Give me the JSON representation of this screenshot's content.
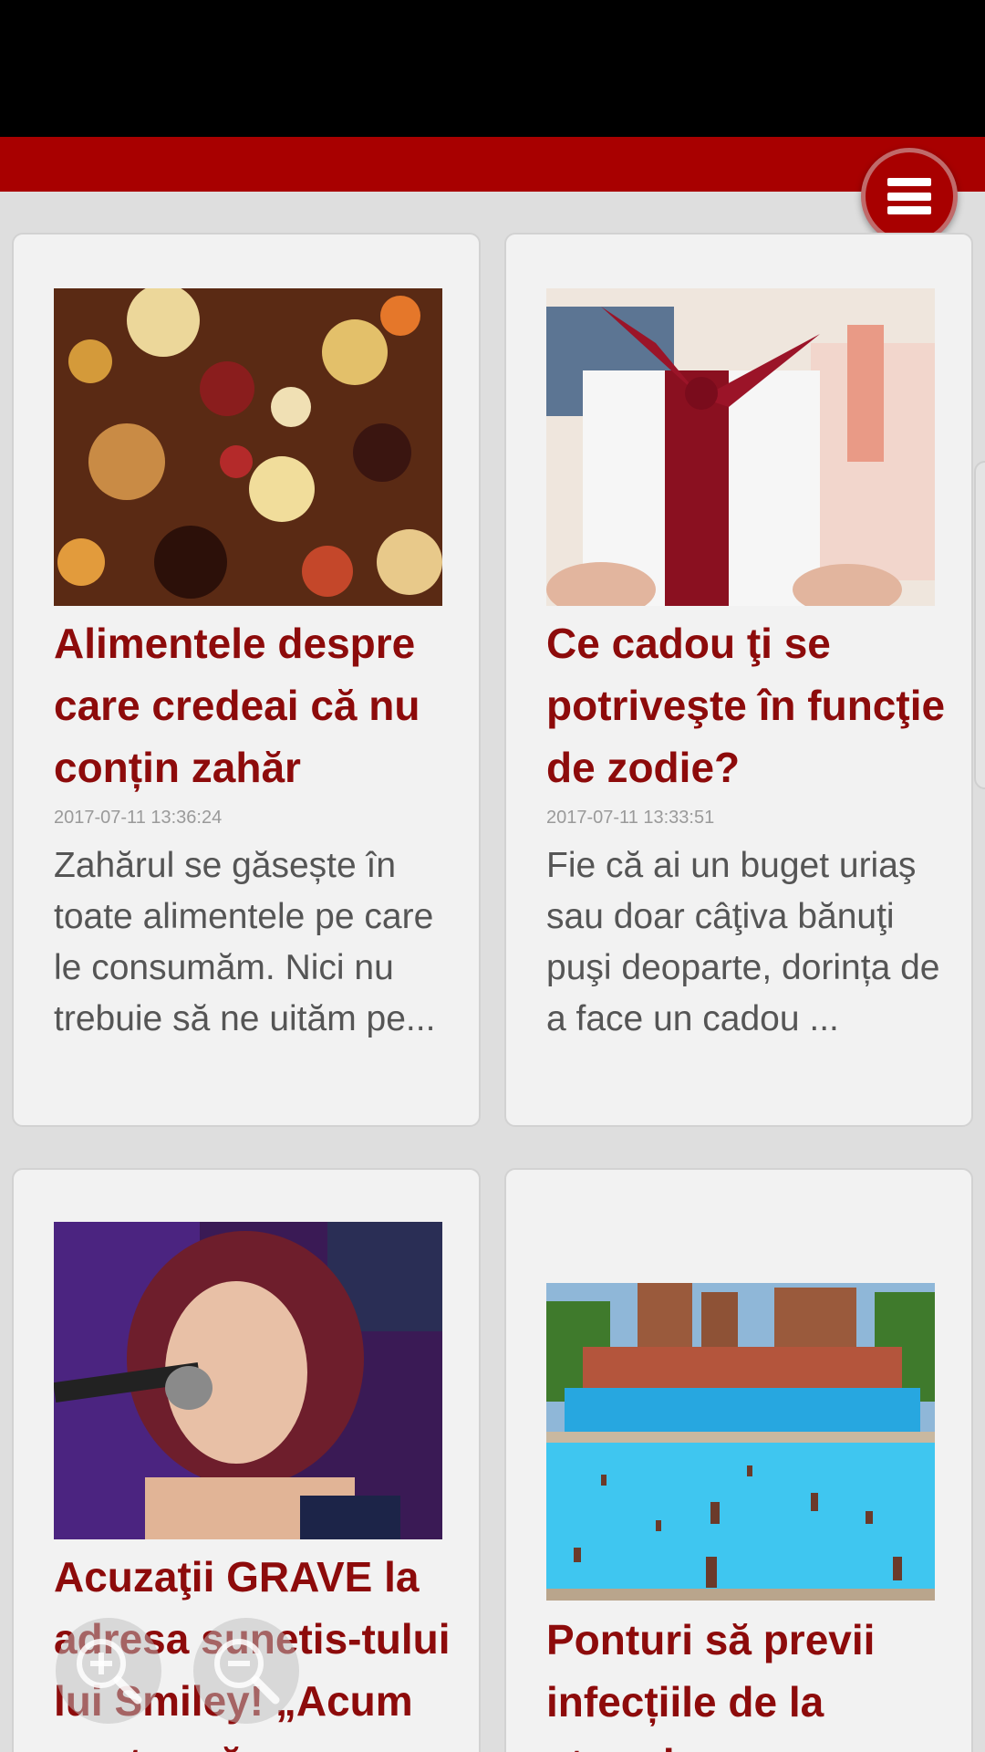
{
  "header": {
    "menu_icon": "hamburger-menu-icon"
  },
  "articles": [
    {
      "title": "Alimentele despre care credeai că nu conțin zahăr",
      "date": "2017-07-11 13:36:24",
      "excerpt": "Zahărul se găsește în toate alimentele pe care le consumăm. Nici nu trebuie să ne uităm pe...",
      "image": "dried-fruit-mix-photo"
    },
    {
      "title": "Ce cadou ţi se potriveşte în funcţie de zodie?",
      "date": "2017-07-11 13:33:51",
      "excerpt": "Fie că ai un buget uriaş sau doar câţiva bănuţi puşi deoparte, dorința de a face un cadou ...",
      "image": "gift-boxes-photo"
    },
    {
      "title": "Acuzaţii GRAVE la adresa sunetis-tului lui Smiley! „Acum pentru că",
      "date": "",
      "excerpt": "",
      "image": "singer-at-microphone-photo"
    },
    {
      "title": "Ponturi să previi infecțiile de la ștrand",
      "date": "",
      "excerpt": "",
      "image": "public-swimming-pool-photo"
    }
  ],
  "zoom": {
    "in_icon": "zoom-in-icon",
    "out_icon": "zoom-out-icon"
  },
  "colors": {
    "brand_red": "#a80000",
    "title_red": "#8d0b0b",
    "background": "#dedede",
    "card": "#f2f2f2"
  }
}
